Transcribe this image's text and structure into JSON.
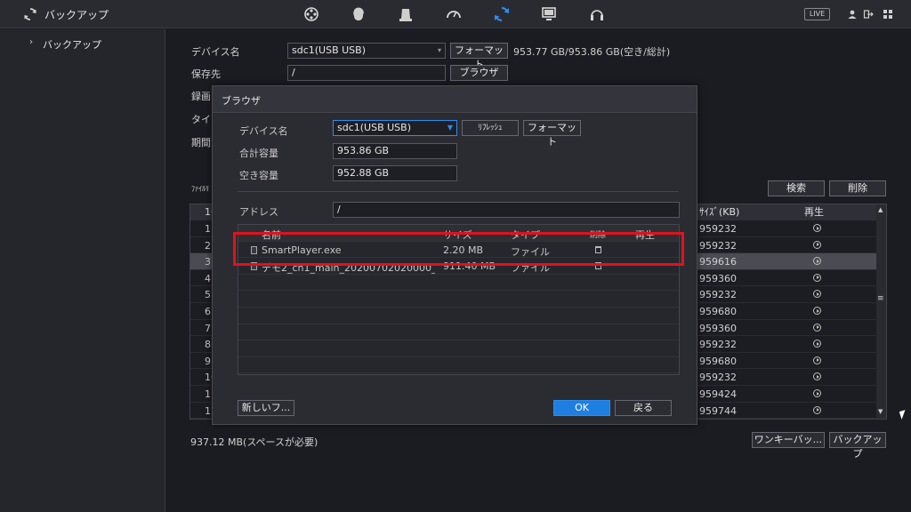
{
  "app": {
    "title": "バックアップ"
  },
  "topbar": {
    "tabs": [
      "reel-icon",
      "brain-icon",
      "disk-icon",
      "gauge-icon",
      "backup-icon",
      "monitor-icon",
      "headset-icon"
    ],
    "active_tab_index": 4,
    "live_label": "LIVE",
    "accent": "#2d8cf0"
  },
  "sidebar": {
    "items": [
      {
        "label": "バックアップ"
      }
    ]
  },
  "main": {
    "device_label": "デバイス名",
    "device_value": "sdc1(USB USB)",
    "format_button": "フォーマット",
    "capacity_text": "953.77 GB/953.86 GB(空き/総計)",
    "save_label": "保存先",
    "save_value": "/",
    "browse_button": "ブラウザ",
    "partial_labels": [
      "録画",
      "タイ",
      "期間"
    ],
    "file_list_label": "ﾌｧｲﾙﾘ",
    "search_button": "検索",
    "delete_button": "削除",
    "table": {
      "first_header": "16",
      "size_header": "ｻｲｽﾞ(KB)",
      "play_header": "再生",
      "rows": [
        {
          "index": "1",
          "size": "959232"
        },
        {
          "index": "2",
          "size": "959232"
        },
        {
          "index": "3",
          "size": "959616"
        },
        {
          "index": "4",
          "size": "959360"
        },
        {
          "index": "5",
          "size": "959232"
        },
        {
          "index": "6",
          "size": "959680"
        },
        {
          "index": "7",
          "size": "959360"
        },
        {
          "index": "8",
          "size": "959232"
        },
        {
          "index": "9",
          "size": "959680"
        },
        {
          "index": "10",
          "size": "959232"
        },
        {
          "index": "11",
          "size": "959424"
        },
        {
          "index": "12",
          "size": "959744"
        }
      ],
      "selected_row": 2
    },
    "space_needed": "937.12 MB(スペースが必要)",
    "onekey_button": "ワンキーバッ...",
    "backup_button": "バックアップ"
  },
  "dialog": {
    "title": "ブラウザ",
    "device_label": "デバイス名",
    "device_value": "sdc1(USB USB)",
    "refresh_button": "ﾘﾌﾚｯｼｭ",
    "format_button": "フォーマット",
    "total_label": "合計容量",
    "total_value": "953.86 GB",
    "free_label": "空き容量",
    "free_value": "952.88 GB",
    "address_label": "アドレス",
    "address_value": "/",
    "columns": {
      "name": "名前",
      "size": "サイズ",
      "type": "タイプ",
      "delete": "削除",
      "play": "再生"
    },
    "files": [
      {
        "name": "SmartPlayer.exe",
        "size": "2.20 MB",
        "type": "ファイル"
      },
      {
        "name": "デモ2_ch1_main_20200702020000_...",
        "size": "911.40 MB",
        "type": "ファイル"
      }
    ],
    "new_folder_button": "新しいフ...",
    "ok_button": "OK",
    "back_button": "戻る"
  }
}
